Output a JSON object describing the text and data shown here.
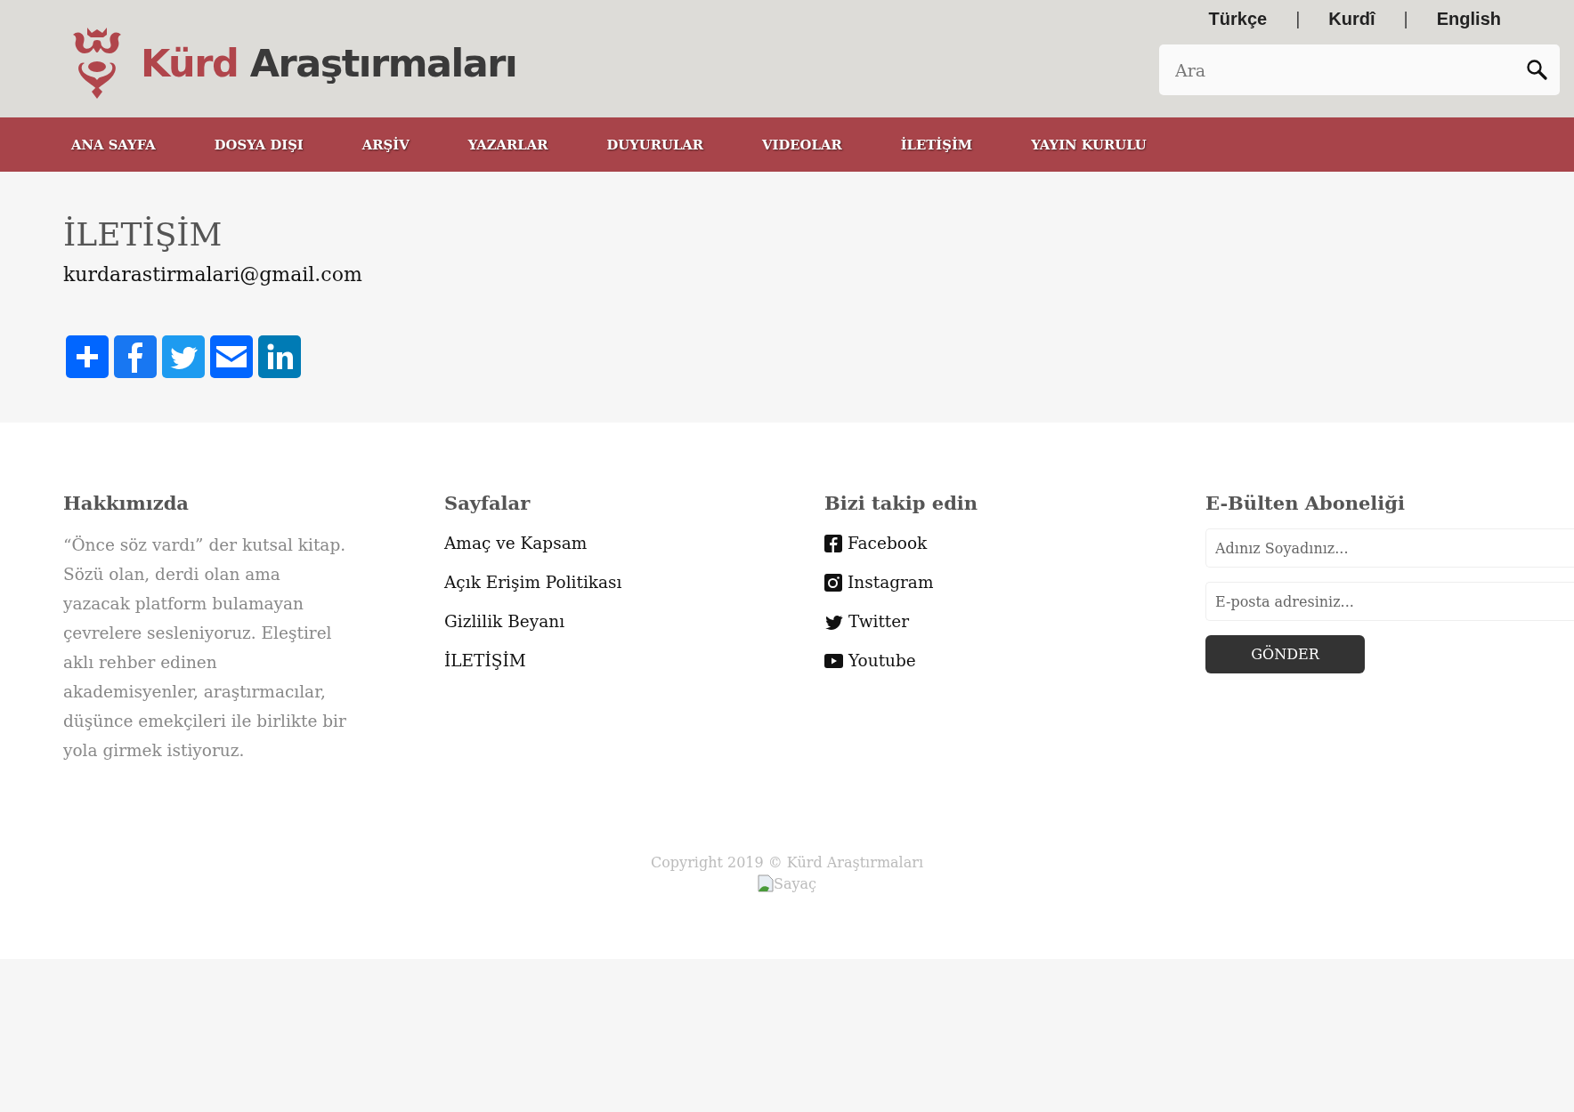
{
  "header": {
    "logo": {
      "first": "Kürd",
      "second": "Araştırmaları"
    },
    "languages": [
      "Türkçe",
      "Kurdî",
      "English"
    ],
    "language_separator": "|",
    "search": {
      "placeholder": "Ara"
    }
  },
  "nav": {
    "items": [
      "ANA SAYFA",
      "DOSYA DIŞI",
      "ARŞİV",
      "YAZARLAR",
      "DUYURULAR",
      "VIDEOLAR",
      "İLETİŞİM",
      "YAYIN KURULU"
    ]
  },
  "page": {
    "title": "İLETİŞİM",
    "email": "kurdarastirmalari@gmail.com",
    "share_buttons": [
      {
        "kind": "share"
      },
      {
        "kind": "facebook"
      },
      {
        "kind": "twitter"
      },
      {
        "kind": "email"
      },
      {
        "kind": "linkedin"
      }
    ]
  },
  "footer": {
    "about": {
      "title": "Hakkımızda",
      "text": "“Önce söz vardı” der kutsal kitap. Sözü olan, derdi olan ama yazacak platform bulamayan çevrelere sesleniyoruz. Eleştirel aklı rehber edinen akademisyenler, araştırmacılar, düşünce emekçileri ile birlikte bir yola girmek istiyoruz."
    },
    "pages": {
      "title": "Sayfalar",
      "links": [
        "Amaç ve Kapsam",
        "Açık Erişim Politikası",
        "Gizlilik Beyanı",
        "İLETİŞİM"
      ]
    },
    "follow": {
      "title": "Bizi takip edin",
      "links": [
        {
          "kind": "facebook",
          "label": "Facebook"
        },
        {
          "kind": "instagram",
          "label": "Instagram"
        },
        {
          "kind": "twitter",
          "label": "Twitter"
        },
        {
          "kind": "youtube",
          "label": "Youtube"
        }
      ]
    },
    "newsletter": {
      "title": "E-Bülten Aboneliği",
      "name_placeholder": "Adınız Soyadınız...",
      "email_placeholder": "E-posta adresiniz...",
      "button": "GÖNDER"
    },
    "copyright": "Copyright 2019 © Kürd Araştırmaları",
    "counter_alt": "Sayaç"
  }
}
